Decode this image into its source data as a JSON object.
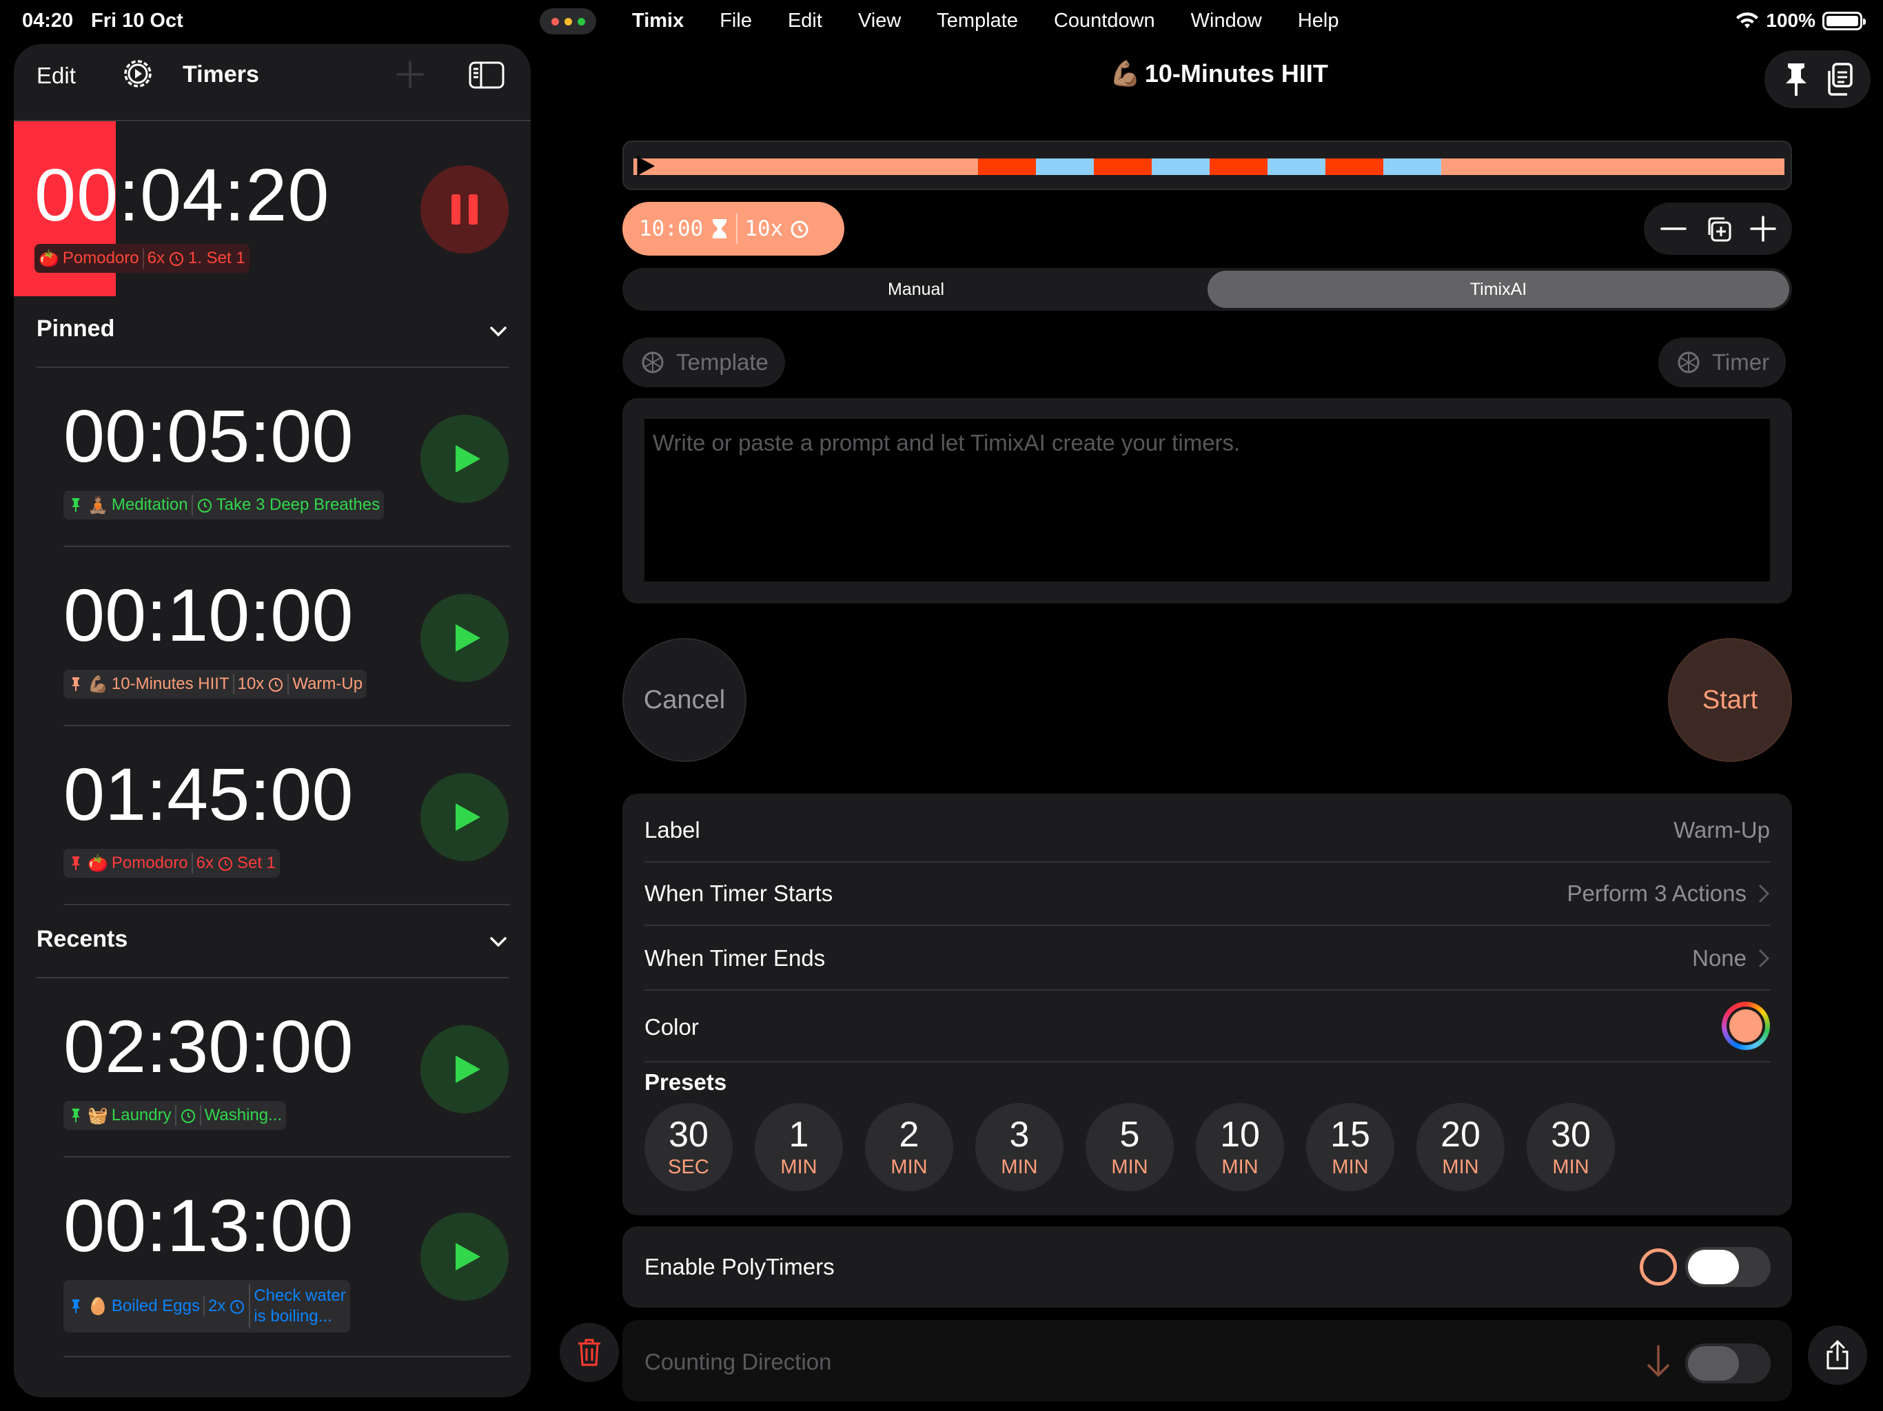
{
  "status_bar": {
    "time": "04:20",
    "date": "Fri 10 Oct",
    "battery": "100%"
  },
  "menu": {
    "app": "Timix",
    "items": [
      "File",
      "Edit",
      "View",
      "Template",
      "Countdown",
      "Window",
      "Help"
    ]
  },
  "sidebar": {
    "edit_label": "Edit",
    "title": "Timers",
    "running": {
      "time": "00:04:20",
      "emoji": "🍅",
      "name": "Pomodoro",
      "repeat": "6x",
      "step": "1. Set 1",
      "color": "#ff2d3b"
    },
    "pinned_title": "Pinned",
    "pinned": [
      {
        "time": "00:05:00",
        "emoji": "🧘🏽",
        "name": "Meditation",
        "repeat": "",
        "step": "Take 3 Deep Breathes",
        "color": "#32d74b"
      },
      {
        "time": "00:10:00",
        "emoji": "💪🏽",
        "name": "10-Minutes HIIT",
        "repeat": "10x",
        "step": "Warm-Up",
        "color": "#ff9e7a"
      },
      {
        "time": "01:45:00",
        "emoji": "🍅",
        "name": "Pomodoro",
        "repeat": "6x",
        "step": "Set 1",
        "color": "#ff3b3b"
      }
    ],
    "recents_title": "Recents",
    "recents": [
      {
        "time": "02:30:00",
        "emoji": "🧺",
        "name": "Laundry",
        "repeat": "",
        "step": "Washing...",
        "color": "#32d74b"
      },
      {
        "time": "00:13:00",
        "emoji": "🥚",
        "name": "Boiled Eggs",
        "repeat": "2x",
        "step_line1": "Check water",
        "step_line2": "is boiling...",
        "color": "#0a84ff"
      }
    ]
  },
  "main": {
    "title_emoji": "💪🏽",
    "title": "10-Minutes HIIT",
    "total_duration": "10:00",
    "repeat": "10x",
    "segment": {
      "manual": "Manual",
      "ai": "TimixAI",
      "selected": "TimixAI"
    },
    "template_btn": "Template",
    "timer_btn": "Timer",
    "prompt_placeholder": "Write or paste a prompt and let TimixAI create your timers.",
    "cancel": "Cancel",
    "start": "Start",
    "settings": {
      "label_title": "Label",
      "label_value": "Warm-Up",
      "starts_title": "When Timer Starts",
      "starts_value": "Perform 3 Actions",
      "ends_title": "When Timer Ends",
      "ends_value": "None",
      "color_title": "Color",
      "color_value": "#ff9e7a",
      "presets_title": "Presets",
      "presets": [
        {
          "n": "30",
          "u": "SEC"
        },
        {
          "n": "1",
          "u": "MIN"
        },
        {
          "n": "2",
          "u": "MIN"
        },
        {
          "n": "3",
          "u": "MIN"
        },
        {
          "n": "5",
          "u": "MIN"
        },
        {
          "n": "10",
          "u": "MIN"
        },
        {
          "n": "15",
          "u": "MIN"
        },
        {
          "n": "20",
          "u": "MIN"
        },
        {
          "n": "30",
          "u": "MIN"
        }
      ]
    },
    "polytimers": {
      "label": "Enable PolyTimers",
      "enabled": false
    },
    "counting": {
      "label": "Counting Direction",
      "enabled": false
    }
  },
  "colors": {
    "accent": "#ff9e7a",
    "segment_red": "#ff3b00",
    "segment_blue": "#8fd0f8",
    "play_green": "#32d74b"
  }
}
